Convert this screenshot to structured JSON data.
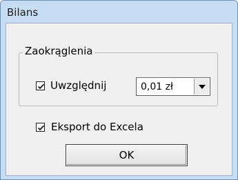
{
  "window": {
    "title": "Bilans"
  },
  "rounding_group": {
    "legend": "Zaokrąglenia",
    "include_checkbox": {
      "label": "Uwzględnij",
      "checked": true
    },
    "rounding_select": {
      "value": "0,01 zł",
      "icon": "chevron-down-icon"
    }
  },
  "export_checkbox": {
    "label": "Eksport do Excela",
    "checked": true
  },
  "ok_button": {
    "label": "OK"
  },
  "colors": {
    "title_bar": "#c6ddf3",
    "client_bg": "#f0f0f0",
    "border": "#6d8fb3"
  }
}
